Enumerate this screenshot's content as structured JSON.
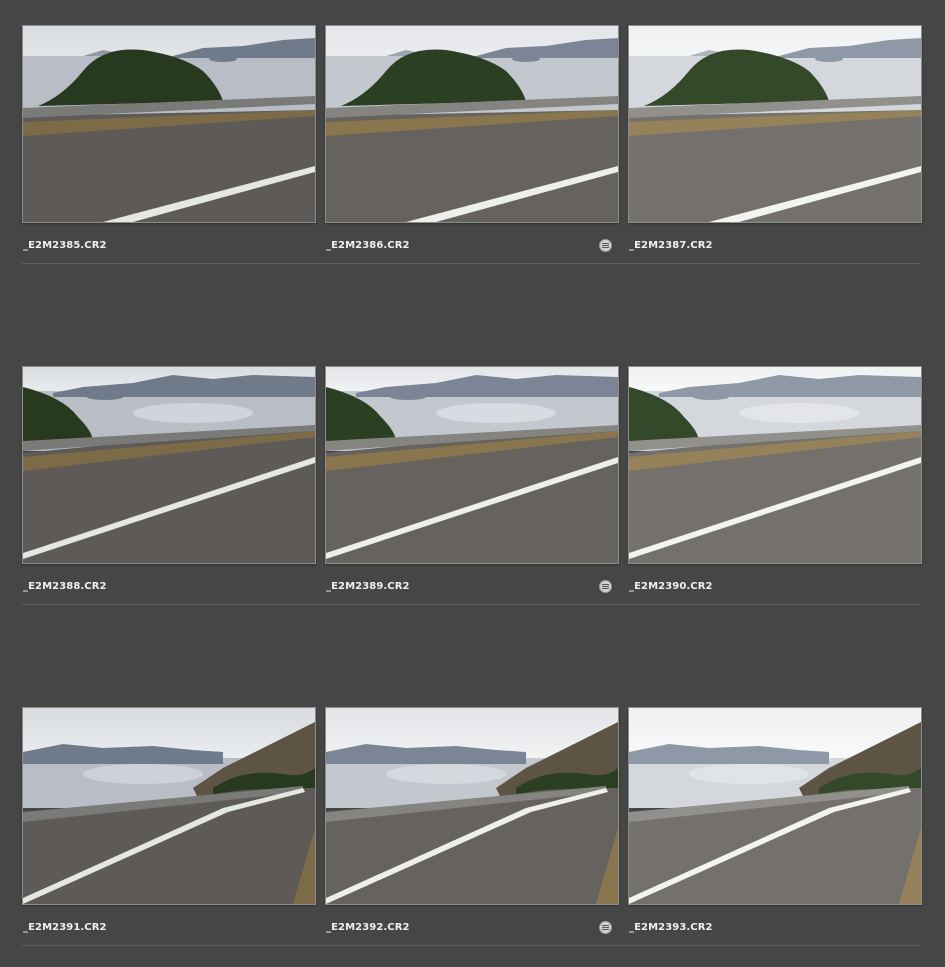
{
  "thumbnails": [
    {
      "name": "_E2M2385.CR2",
      "scene": "tree",
      "tone": "dark",
      "badge": false
    },
    {
      "name": "_E2M2386.CR2",
      "scene": "tree",
      "tone": "mid",
      "badge": true
    },
    {
      "name": "_E2M2387.CR2",
      "scene": "tree",
      "tone": "light",
      "badge": false
    },
    {
      "name": "_E2M2388.CR2",
      "scene": "sea",
      "tone": "dark",
      "badge": false
    },
    {
      "name": "_E2M2389.CR2",
      "scene": "sea",
      "tone": "mid",
      "badge": true
    },
    {
      "name": "_E2M2390.CR2",
      "scene": "sea",
      "tone": "light",
      "badge": false
    },
    {
      "name": "_E2M2391.CR2",
      "scene": "curve",
      "tone": "dark",
      "badge": false
    },
    {
      "name": "_E2M2392.CR2",
      "scene": "curve",
      "tone": "mid",
      "badge": true
    },
    {
      "name": "_E2M2393.CR2",
      "scene": "curve",
      "tone": "light",
      "badge": false
    }
  ],
  "icons": {
    "badge": "stack-badge-icon"
  }
}
